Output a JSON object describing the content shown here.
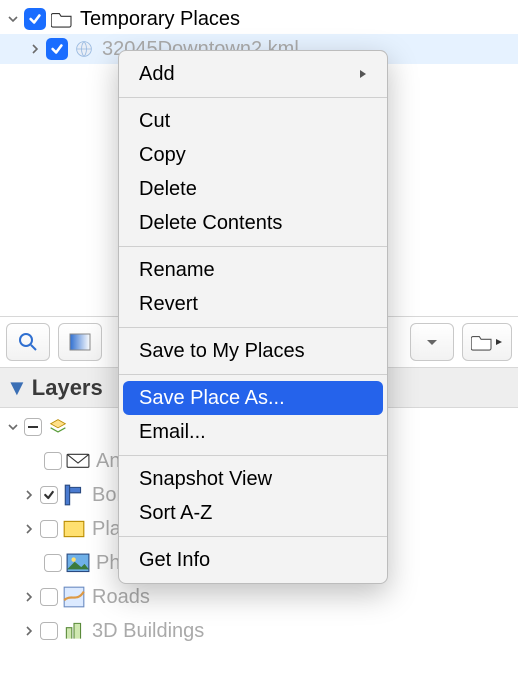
{
  "places": {
    "root": {
      "label": "Temporary Places",
      "checked": true
    },
    "child": {
      "label": "32045Downtown2.kml",
      "checked": true
    }
  },
  "layers_header": "Layers",
  "layers": [
    {
      "label": "Announcements"
    },
    {
      "label": "Borders and Labels"
    },
    {
      "label": "Places"
    },
    {
      "label": "Photos"
    },
    {
      "label": "Roads"
    },
    {
      "label": "3D Buildings"
    }
  ],
  "menu": {
    "add": "Add",
    "cut": "Cut",
    "copy": "Copy",
    "delete": "Delete",
    "delete_contents": "Delete Contents",
    "rename": "Rename",
    "revert": "Revert",
    "save_my_places": "Save to My Places",
    "save_place_as": "Save Place As...",
    "email": "Email...",
    "snapshot": "Snapshot View",
    "sort": "Sort A-Z",
    "get_info": "Get Info"
  }
}
